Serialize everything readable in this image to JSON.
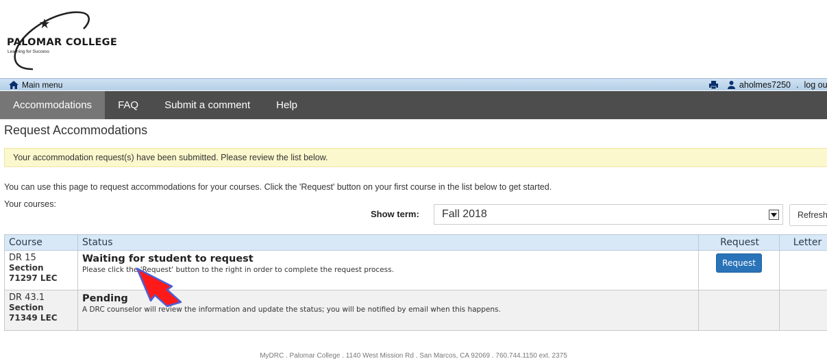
{
  "logo": {
    "name": "PALOMAR COLLEGE",
    "tagline": "Learning for Success"
  },
  "topbar": {
    "home_label": "Main menu",
    "username": "aholmes7250",
    "separator": ".",
    "logout_label": "log out"
  },
  "nav": {
    "items": [
      {
        "label": "Accommodations",
        "active": true
      },
      {
        "label": "FAQ"
      },
      {
        "label": "Submit a comment"
      },
      {
        "label": "Help"
      }
    ]
  },
  "page": {
    "title": "Request Accommodations",
    "alert": "Your accommodation request(s) have been submitted. Please review the list below.",
    "intro": "You can use this page to request accommodations for your courses. Click the 'Request' button on your first course in the list below to get started.",
    "your_courses_label": "Your courses:",
    "show_term_label": "Show term:",
    "term_value": "Fall 2018",
    "refresh_label": "Refresh"
  },
  "table": {
    "headers": {
      "course": "Course",
      "status": "Status",
      "request": "Request",
      "letter": "Letter"
    },
    "rows": [
      {
        "course": "DR 15",
        "section_label": "Section",
        "section": "71297 LEC",
        "status_title": "Waiting for student to request",
        "status_desc": "Please click the 'Request' button to the right in order to complete the request process.",
        "request_label": "Request"
      },
      {
        "course": "DR 43.1",
        "section_label": "Section",
        "section": "71349 LEC",
        "status_title": "Pending",
        "status_desc": "A DRC counselor will review the information and update the status; you will be notified by email when this happens."
      }
    ]
  },
  "annotation": {
    "arrow_color": "#ff1a1a",
    "arrow_outline": "#4a5fd8"
  },
  "footer": "MyDRC . Palomar College . 1140 West Mission Rd . San Marcos, CA 92069 . 760.744.1150 ext. 2375"
}
